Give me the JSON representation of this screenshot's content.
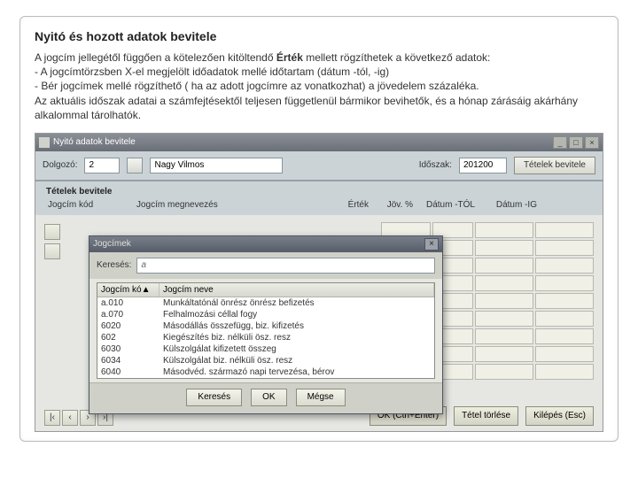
{
  "doc": {
    "title": "Nyitó és hozott adatok bevitele",
    "line1": "A jogcím jellegétől függően a kötelezően kitöltendő ",
    "bold": "Érték",
    "line1b": " mellett rögzíthetek a következő adatok:",
    "line2": "- A jogcímtörzsben X-el megjelölt időadatok mellé időtartam (dátum -tól, -ig)",
    "line3": "- Bér jogcímek mellé rögzíthető ( ha az adott jogcímre az vonatkozhat) a jövedelem százaléka.",
    "line4": "Az aktuális időszak adatai a számfejtésektől teljesen függetlenül bármikor bevihetők, és a hónap zárásáig akárhány alkalommal tárolhatók."
  },
  "app": {
    "titlebar": "Nyitó adatok bevitele",
    "top": {
      "dolgozo_label": "Dolgozó:",
      "dolgozo_id": "2",
      "dolgozo_name": "Nagy Vilmos",
      "idoszak_label": "Időszak:",
      "idoszak_value": "201200",
      "action_label": "Tételek bevitele"
    },
    "subheader": "Tételek bevitele",
    "cols": {
      "kod": "Jogcím kód",
      "meg": "Jogcím megnevezés",
      "ert": "Érték",
      "jov": "Jöv. %",
      "tol": "Dátum -TÓL",
      "ig": "Dátum -IG"
    },
    "bottom": {
      "ok": "OK (Ctrl+Enter)",
      "torles": "Tétel törlése",
      "kilepes": "Kilépés (Esc)"
    }
  },
  "modal": {
    "title": "Jogcímek",
    "search_label": "Keresés:",
    "search_value": "a",
    "hdr_kod": "Jogcím kó▲",
    "hdr_meg": "Jogcím neve",
    "rows": [
      {
        "kod": "a.010",
        "meg": "Munkáltatónál önrész önrész befizetés"
      },
      {
        "kod": "a.070",
        "meg": "Felhalmozási céllal fogy"
      },
      {
        "kod": "6020",
        "meg": "Másodállás összefügg, biz. kifizetés"
      },
      {
        "kod": "602 ",
        "meg": "Kiegészítés biz. nélküli ösz. resz"
      },
      {
        "kod": "6030",
        "meg": "Külszolgálat kifizetett összeg"
      },
      {
        "kod": "6034",
        "meg": "Külszolgálat biz. nélküli ösz. resz"
      },
      {
        "kod": "6040",
        "meg": "Másodvéd. származó napi tervezésa, bérov"
      }
    ],
    "btn_kereses": "Keresés",
    "btn_ok": "OK",
    "btn_megse": "Mégse"
  }
}
